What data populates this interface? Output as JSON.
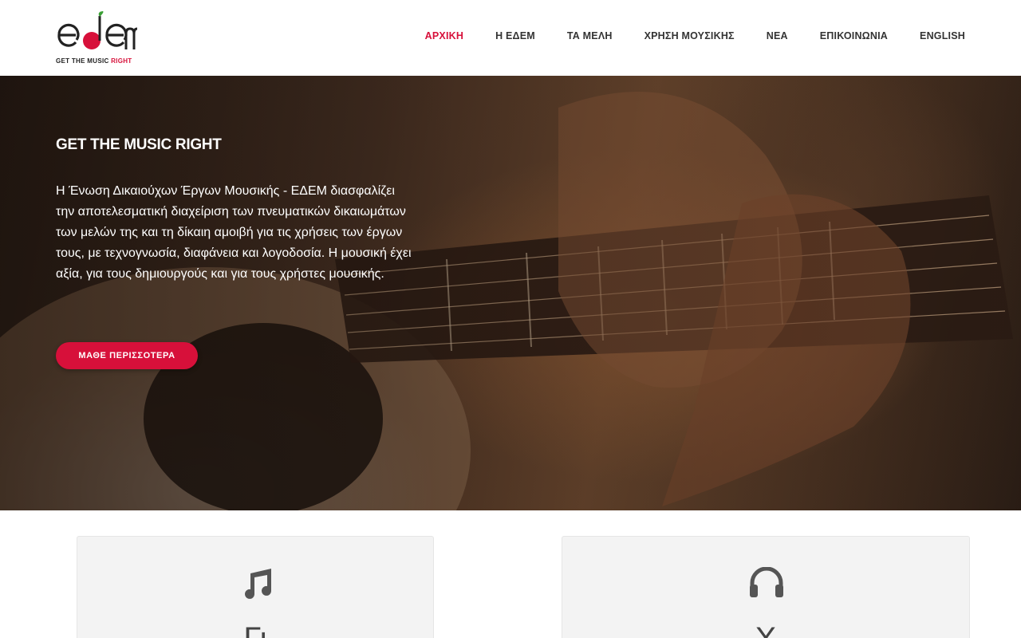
{
  "header": {
    "logo_text": "edem",
    "logo_tagline_main": "GET THE MUSIC ",
    "logo_tagline_accent": "RIGHT",
    "brand_color": "#d7103a"
  },
  "nav": {
    "items": [
      {
        "label": "ΑΡΧΙΚΗ",
        "active": true
      },
      {
        "label": "Η ΕΔΕΜ",
        "active": false
      },
      {
        "label": "ΤΑ ΜΕΛΗ",
        "active": false
      },
      {
        "label": "ΧΡΗΣΗ ΜΟΥΣΙΚΗΣ",
        "active": false
      },
      {
        "label": "ΝΕΑ",
        "active": false
      },
      {
        "label": "ΕΠΙΚΟΙΝΩΝΙΑ",
        "active": false
      },
      {
        "label": "ENGLISH",
        "active": false
      }
    ]
  },
  "hero": {
    "title": "GET THE MUSIC RIGHT",
    "text": "Η Ένωση Δικαιούχων Έργων Μουσικής - ΕΔΕΜ διασφαλίζει την αποτελεσματική διαχείριση των πνευματικών δικαιωμάτων των μελών της και τη δίκαιη αμοιβή για τις χρήσεις των έργων τους, με τεχνογνωσία, διαφάνεια και λογοδοσία. Η μουσική έχει αξία, για τους δημιουργούς και για τους χρήστες μουσικής.",
    "button_label": "ΜΑΘΕ ΠΕΡΙΣΣΟΤΕΡΑ",
    "image": "acoustic-guitar-photo"
  },
  "cards": [
    {
      "icon": "music-note-icon",
      "title": "Γι"
    },
    {
      "icon": "headphones-icon",
      "title": "Χ"
    }
  ]
}
